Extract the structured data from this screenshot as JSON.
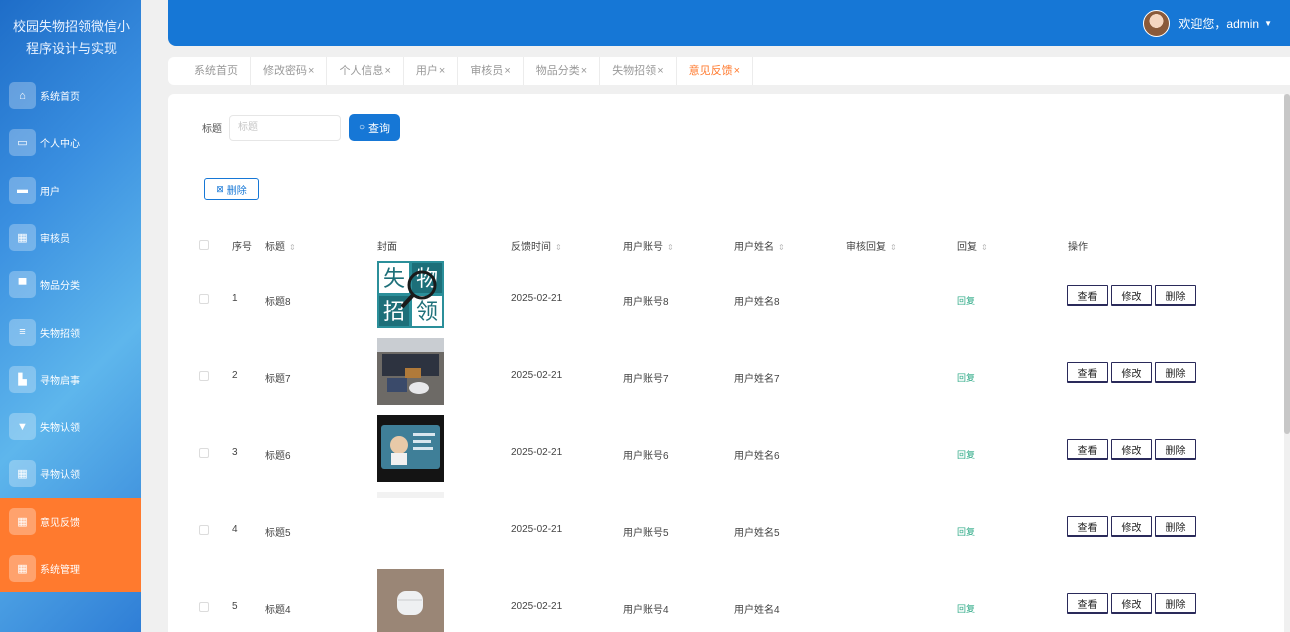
{
  "app": {
    "title": "校园失物招领微信小程序设计与实现"
  },
  "header": {
    "welcome": "欢迎您，admin"
  },
  "sidebar": {
    "items": [
      {
        "label": "系统首页",
        "icon": "home-icon"
      },
      {
        "label": "个人中心",
        "icon": "user-card-icon"
      },
      {
        "label": "用户",
        "icon": "briefcase-icon"
      },
      {
        "label": "审核员",
        "icon": "grid-icon"
      },
      {
        "label": "物品分类",
        "icon": "monitor-icon"
      },
      {
        "label": "失物招领",
        "icon": "list-icon"
      },
      {
        "label": "寻物启事",
        "icon": "chart-icon"
      },
      {
        "label": "失物认领",
        "icon": "trophy-icon"
      },
      {
        "label": "寻物认领",
        "icon": "grid-icon"
      },
      {
        "label": "意见反馈",
        "icon": "grid-icon"
      },
      {
        "label": "系统管理",
        "icon": "grid-icon"
      }
    ],
    "active_index": 9
  },
  "tabs": [
    {
      "label": "系统首页",
      "closable": false
    },
    {
      "label": "修改密码",
      "closable": true
    },
    {
      "label": "个人信息",
      "closable": true
    },
    {
      "label": "用户",
      "closable": true
    },
    {
      "label": "审核员",
      "closable": true
    },
    {
      "label": "物品分类",
      "closable": true
    },
    {
      "label": "失物招领",
      "closable": true
    },
    {
      "label": "意见反馈",
      "closable": true
    }
  ],
  "tab_close_glyph": "×",
  "search": {
    "label": "标题",
    "placeholder": "标题",
    "value": "",
    "button_label": "查询"
  },
  "toolbar": {
    "delete_label": "删除"
  },
  "table": {
    "columns": [
      "序号",
      "标题",
      "封面",
      "反馈时间",
      "用户账号",
      "用户姓名",
      "审核回复",
      "回复",
      "操作"
    ],
    "sortable": [
      false,
      true,
      false,
      true,
      true,
      true,
      true,
      true,
      false
    ],
    "actions": {
      "view": "查看",
      "edit": "修改",
      "delete": "删除"
    },
    "rows": [
      {
        "no": "1",
        "title": "标题8",
        "cover": "poster",
        "cover_text": [
          "失",
          "物",
          "招",
          "领"
        ],
        "time": "2025-02-21",
        "account": "用户账号8",
        "name": "用户姓名8",
        "audit_reply": "",
        "reply": "回复"
      },
      {
        "no": "2",
        "title": "标题7",
        "cover": "photo-desk",
        "time": "2025-02-21",
        "account": "用户账号7",
        "name": "用户姓名7",
        "audit_reply": "",
        "reply": "回复"
      },
      {
        "no": "3",
        "title": "标题6",
        "cover": "photo-card",
        "time": "2025-02-21",
        "account": "用户账号6",
        "name": "用户姓名6",
        "audit_reply": "",
        "reply": "回复"
      },
      {
        "no": "4",
        "title": "标题5",
        "cover": "none",
        "time": "2025-02-21",
        "account": "用户账号5",
        "name": "用户姓名5",
        "audit_reply": "",
        "reply": "回复"
      },
      {
        "no": "5",
        "title": "标题4",
        "cover": "photo-earbuds",
        "time": "2025-02-21",
        "account": "用户账号4",
        "name": "用户姓名4",
        "audit_reply": "",
        "reply": "回复"
      }
    ]
  },
  "colors": {
    "primary": "#1677d6",
    "active_menu": "#ff7a2e",
    "active_tab": "#ff7a2e",
    "reply_link": "#2aa884"
  }
}
